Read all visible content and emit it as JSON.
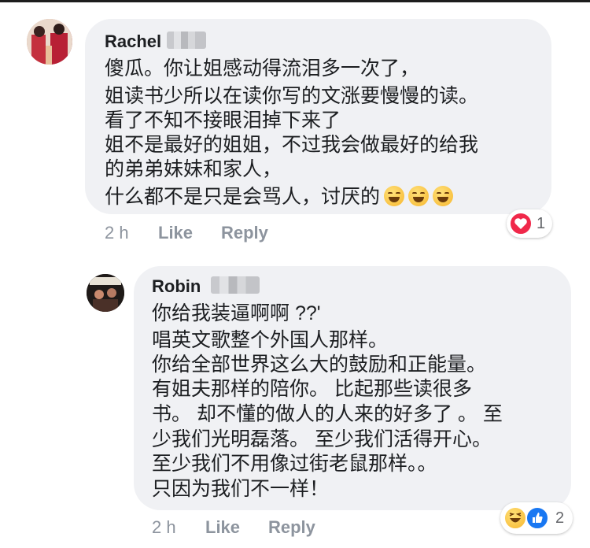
{
  "comments": [
    {
      "author": "Rachel",
      "lines": [
        "傻瓜。你让姐感动得流泪多一次了，",
        "姐读书少所以在读你写的文涨要慢慢的读。",
        "看了不知不接眼泪掉下来了",
        "姐不是最好的姐姐，不过我会做最好的给我",
        "的弟弟妹妹和家人，",
        "什么都不是只是会骂人，讨厌的"
      ],
      "inline_emoji": [
        "grinning-squint-emoji",
        "grinning-squint-emoji",
        "grinning-squint-emoji"
      ],
      "time": "2 h",
      "like_label": "Like",
      "reply_label": "Reply",
      "reaction_icons": [
        "love-reaction-icon"
      ],
      "reaction_count": "1"
    },
    {
      "author": "Robin",
      "lines": [
        "你给我装逼啊啊 ??'",
        "唱英文歌整个外国人那样。",
        "你给全部世界这么大的鼓励和正能量。",
        "有姐夫那样的陪你。 比起那些读很多",
        "书。 却不懂的做人的人来的好多了 。 至",
        "少我们光明磊落。 至少我们活得开心。",
        "至少我们不用像过街老鼠那样。。",
        "只因为我们不一样！"
      ],
      "time": "2 h",
      "like_label": "Like",
      "reply_label": "Reply",
      "reaction_icons": [
        "haha-reaction-icon",
        "like-reaction-icon"
      ],
      "reaction_count": "2"
    }
  ],
  "colors": {
    "bubble": "#f0f1f4",
    "meta_text": "#8d949e",
    "love_red": "#f0284a",
    "like_blue": "#1877f2"
  }
}
